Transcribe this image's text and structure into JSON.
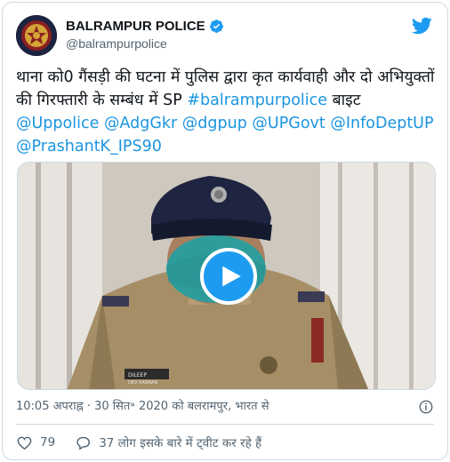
{
  "account": {
    "display_name": "BALRAMPUR POLICE",
    "handle": "@balrampurpolice"
  },
  "tweet": {
    "text_segments": [
      {
        "t": "थाना को0 गैंसड़ी की घटना में पुलिस द्वारा कृत कार्यवाही और दो अभियुक्तों की गिरफ्तारी के सम्बंध में SP ",
        "kind": "text"
      },
      {
        "t": "#balrampurpolice",
        "kind": "hashtag"
      },
      {
        "t": " बाइट ",
        "kind": "text"
      },
      {
        "t": "@Uppolice",
        "kind": "mention"
      },
      {
        "t": " ",
        "kind": "text"
      },
      {
        "t": "@AdgGkr",
        "kind": "mention"
      },
      {
        "t": " ",
        "kind": "text"
      },
      {
        "t": "@dgpup",
        "kind": "mention"
      },
      {
        "t": " ",
        "kind": "text"
      },
      {
        "t": "@UPGovt",
        "kind": "mention"
      },
      {
        "t": " ",
        "kind": "text"
      },
      {
        "t": "@InfoDeptUP",
        "kind": "mention"
      },
      {
        "t": " ",
        "kind": "text"
      },
      {
        "t": "@PrashantK_IPS90",
        "kind": "mention"
      }
    ]
  },
  "media": {
    "type": "video",
    "name_plate_line1": "DILEEP",
    "name_plate_line2": "DEV KANNAN"
  },
  "meta": {
    "timestamp": "10:05 अपराह्न · 30 सित॰ 2020 को बलरामपुर, भारत से"
  },
  "actions": {
    "likes": "79",
    "talk_label": "37 लोग इसके बारे में ट्वीट कर रहे हैं"
  },
  "colors": {
    "link": "#1b95e0",
    "twitter_blue": "#1d9bf0",
    "muted": "#536471",
    "border": "#cfd9de"
  },
  "icons": [
    "verified-badge-icon",
    "twitter-bird-icon",
    "play-icon",
    "info-icon",
    "heart-icon",
    "reply-bubble-icon"
  ]
}
